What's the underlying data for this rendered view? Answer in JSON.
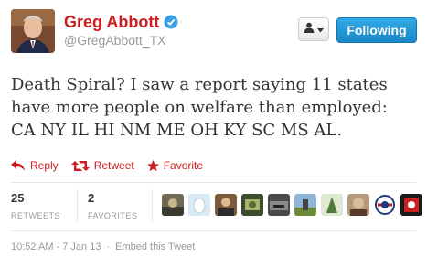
{
  "header": {
    "full_name": "Greg Abbott",
    "screen_name": "@GregAbbott_TX",
    "follow_label": "Following",
    "verified_icon": "verified-badge-icon",
    "user_menu_icon": "user-dropdown-icon"
  },
  "tweet": {
    "lines": [
      "Death Spiral? I saw a report saying 11 states",
      "have more people on welfare than employed:",
      "CA NY IL HI NM ME OH KY SC MS AL."
    ]
  },
  "actions": {
    "reply": "Reply",
    "retweet": "Retweet",
    "favorite": "Favorite"
  },
  "stats": {
    "retweets_count": "25",
    "retweets_label": "RETWEETS",
    "favorites_count": "2",
    "favorites_label": "FAVORITES"
  },
  "footer": {
    "timestamp": "10:52 AM - 7 Jan 13",
    "separator": "·",
    "embed": "Embed this Tweet"
  },
  "colors": {
    "accent": "#cc1d20",
    "follow_button": "#2a9ddd",
    "muted": "#999999"
  }
}
